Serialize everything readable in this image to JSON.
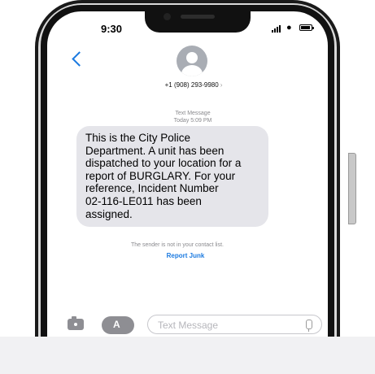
{
  "status_bar": {
    "time": "9:30"
  },
  "header": {
    "back_icon": "chevron-left-icon",
    "avatar_icon": "person-icon",
    "contact_number": "+1 (908) 293-9980",
    "contact_chevron": "›"
  },
  "conversation": {
    "message_type": "Text Message",
    "timestamp": "Today 5:09 PM",
    "message_lines": [
      "This is the City Police",
      "Department. A unit has been",
      "dispatched to your location for a",
      "report of BURGLARY. For your",
      "reference, Incident Number",
      "02-116-LE011 has been",
      "assigned."
    ],
    "notice": "The sender is not in your contact list.",
    "report_junk": "Report Junk"
  },
  "composer": {
    "camera_icon": "camera-icon",
    "apps_icon": "app-store-icon",
    "apps_glyph": "A",
    "placeholder": "Text Message",
    "mic_icon": "microphone-icon"
  },
  "colors": {
    "accent": "#1b7ae0",
    "bubble": "#e5e5ea",
    "secondary_text": "#8a8a8e"
  }
}
